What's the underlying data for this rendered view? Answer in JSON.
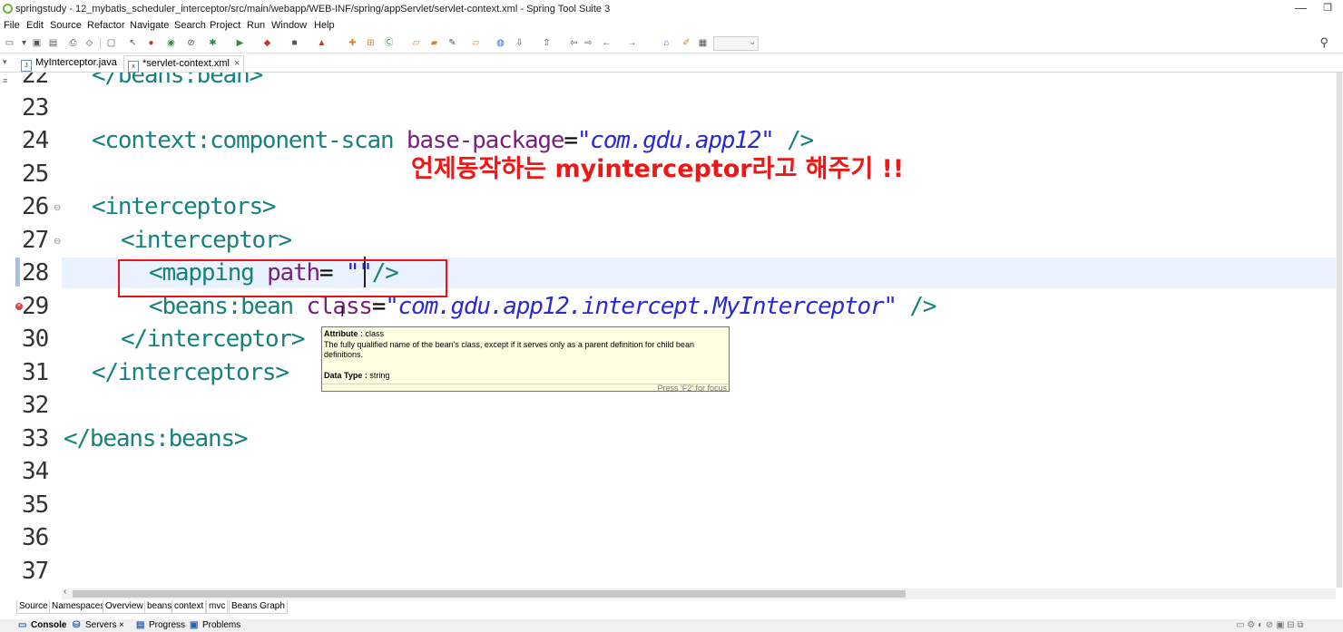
{
  "window": {
    "title": "springstudy - 12_mybatis_scheduler_interceptor/src/main/webapp/WEB-INF/spring/appServlet/servlet-context.xml - Spring Tool Suite 3"
  },
  "menu": [
    "File",
    "Edit",
    "Source",
    "Refactor",
    "Navigate",
    "Search",
    "Project",
    "Run",
    "Window",
    "Help"
  ],
  "editor_tabs": [
    {
      "label": "MyInterceptor.java",
      "icon": "java-file-icon"
    },
    {
      "label": "*servlet-context.xml",
      "icon": "xml-file-icon",
      "close": "×"
    }
  ],
  "lines": [
    "22",
    "23",
    "24",
    "25",
    "26",
    "27",
    "28",
    "29",
    "30",
    "31",
    "32",
    "33",
    "34",
    "35",
    "36",
    "37"
  ],
  "code": {
    "l22": "</beans:bean>",
    "l24_tag": "<context:component-scan ",
    "l24_attr": "base-package",
    "l24_eq": "=",
    "l24_val": "\"com.gdu.app12\"",
    "l24_end": " />",
    "l26": "<interceptors>",
    "l27": "<interceptor>",
    "l28_tag": "<mapping ",
    "l28_attr": "path",
    "l28_eq": "= ",
    "l28_val": "\"\"",
    "l28_end": "/>",
    "l29_tag": "<beans:bean ",
    "l29_attr": "class",
    "l29_eq": "=",
    "l29_val": "\"com.gdu.app12.intercept.MyInterceptor\"",
    "l29_end": " />",
    "l30": "</interceptor>",
    "l31": "</interceptors>",
    "l33": "</beans:beans>"
  },
  "annotation": "언제동작하는 myinterceptor라고 해주기 !!",
  "tooltip": {
    "attribute_label": "Attribute : ",
    "attribute_value": "class",
    "description": "The fully qualified name of the bean's class, except if it serves only as a parent definition for child bean definitions.",
    "datatype_label": "Data Type : ",
    "datatype_value": "string",
    "focus_hint": "Press 'F2' for focus"
  },
  "bottom_tabs": [
    "Source",
    "Namespaces",
    "Overview",
    "beans",
    "context",
    "mvc",
    "Beans Graph"
  ],
  "views": [
    "Console",
    "Servers",
    "Progress",
    "Problems"
  ],
  "colors": {
    "tag": "#17827b",
    "attr": "#7b1f7d",
    "value": "#2a2ad1",
    "annotation": "#ef1616"
  }
}
